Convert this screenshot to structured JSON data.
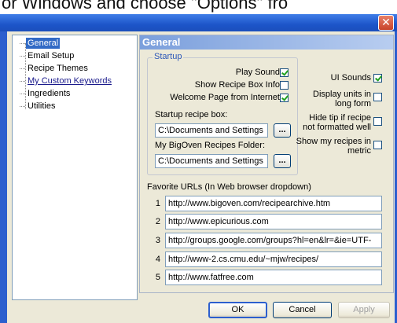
{
  "caption": "or Windows and choose \"Options\" fro",
  "tree": {
    "items": [
      {
        "label": "General"
      },
      {
        "label": "Email Setup"
      },
      {
        "label": "Recipe Themes"
      },
      {
        "label": "My Custom Keywords"
      },
      {
        "label": "Ingredients"
      },
      {
        "label": "Utilities"
      }
    ]
  },
  "general": {
    "title": "General",
    "startup": {
      "legend": "Startup",
      "play_sound": {
        "label": "Play Sound",
        "checked": true
      },
      "show_recipe_box_info": {
        "label": "Show Recipe Box Info",
        "checked": false
      },
      "welcome_page": {
        "label": "Welcome Page from Internet",
        "checked": true
      },
      "startup_box_label": "Startup recipe box:",
      "startup_box_value": "C:\\Documents and Settings",
      "bigoven_folder_label": "My BigOven Recipes Folder:",
      "bigoven_folder_value": "C:\\Documents and Settings",
      "browse_label": "..."
    },
    "right_options": {
      "ui_sounds": {
        "label": "UI Sounds",
        "checked": true
      },
      "display_units": {
        "label_line1": "Display units in",
        "label_line2": "long form",
        "checked": false
      },
      "hide_tip": {
        "label_line1": "Hide tip if recipe",
        "label_line2": "not formatted well",
        "checked": false
      },
      "show_metric": {
        "label_line1": "Show my recipes in",
        "label_line2": "metric",
        "checked": false
      }
    },
    "favorites": {
      "label": "Favorite URLs (In Web browser dropdown)",
      "urls": [
        {
          "num": "1",
          "value": "http://www.bigoven.com/recipearchive.htm"
        },
        {
          "num": "2",
          "value": "http://www.epicurious.com"
        },
        {
          "num": "3",
          "value": "http://groups.google.com/groups?hl=en&lr=&ie=UTF-"
        },
        {
          "num": "4",
          "value": "http://www-2.cs.cmu.edu/~mjw/recipes/"
        },
        {
          "num": "5",
          "value": "http://www.fatfree.com"
        }
      ]
    }
  },
  "buttons": {
    "ok": "OK",
    "cancel": "Cancel",
    "apply": "Apply"
  },
  "window": {
    "close_glyph": "✕"
  },
  "colors": {
    "accent": "#316ac5",
    "check": "#21a121",
    "title_bar": "#2c5fce"
  }
}
